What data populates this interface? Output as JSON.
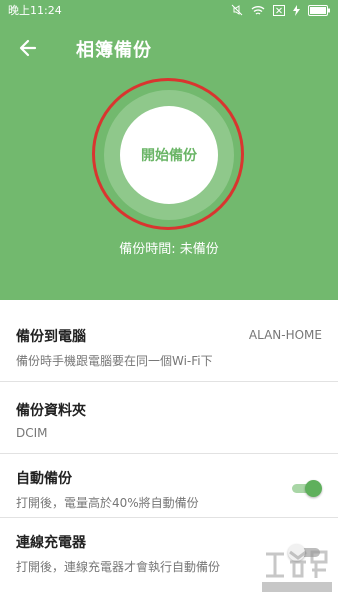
{
  "status_bar": {
    "time": "晚上11:24",
    "icons": [
      "mute-icon",
      "wifi-icon",
      "notification-x-icon",
      "charging-icon",
      "battery-icon"
    ]
  },
  "header": {
    "title": "相簿備份",
    "back_icon": "back-arrow-icon",
    "start_button_label": "開始備份",
    "backup_time": "備份時間: 未備份"
  },
  "settings": {
    "backup_to_pc": {
      "title": "備份到電腦",
      "subtitle": "備份時手機跟電腦要在同一個Wi-Fi下",
      "value": "ALAN-HOME"
    },
    "backup_folder": {
      "title": "備份資料夾",
      "subtitle": "DCIM"
    },
    "auto_backup": {
      "title": "自動備份",
      "subtitle": "打開後，電量高於40%將自動備份",
      "enabled": true
    },
    "charger_backup": {
      "title": "連線充電器",
      "subtitle": "打開後，連線充電器才會執行自動備份",
      "enabled": false
    }
  },
  "colors": {
    "header_green": "#72b96e",
    "accent_green": "#5fb05c",
    "annotation_red": "#d9352f"
  }
}
